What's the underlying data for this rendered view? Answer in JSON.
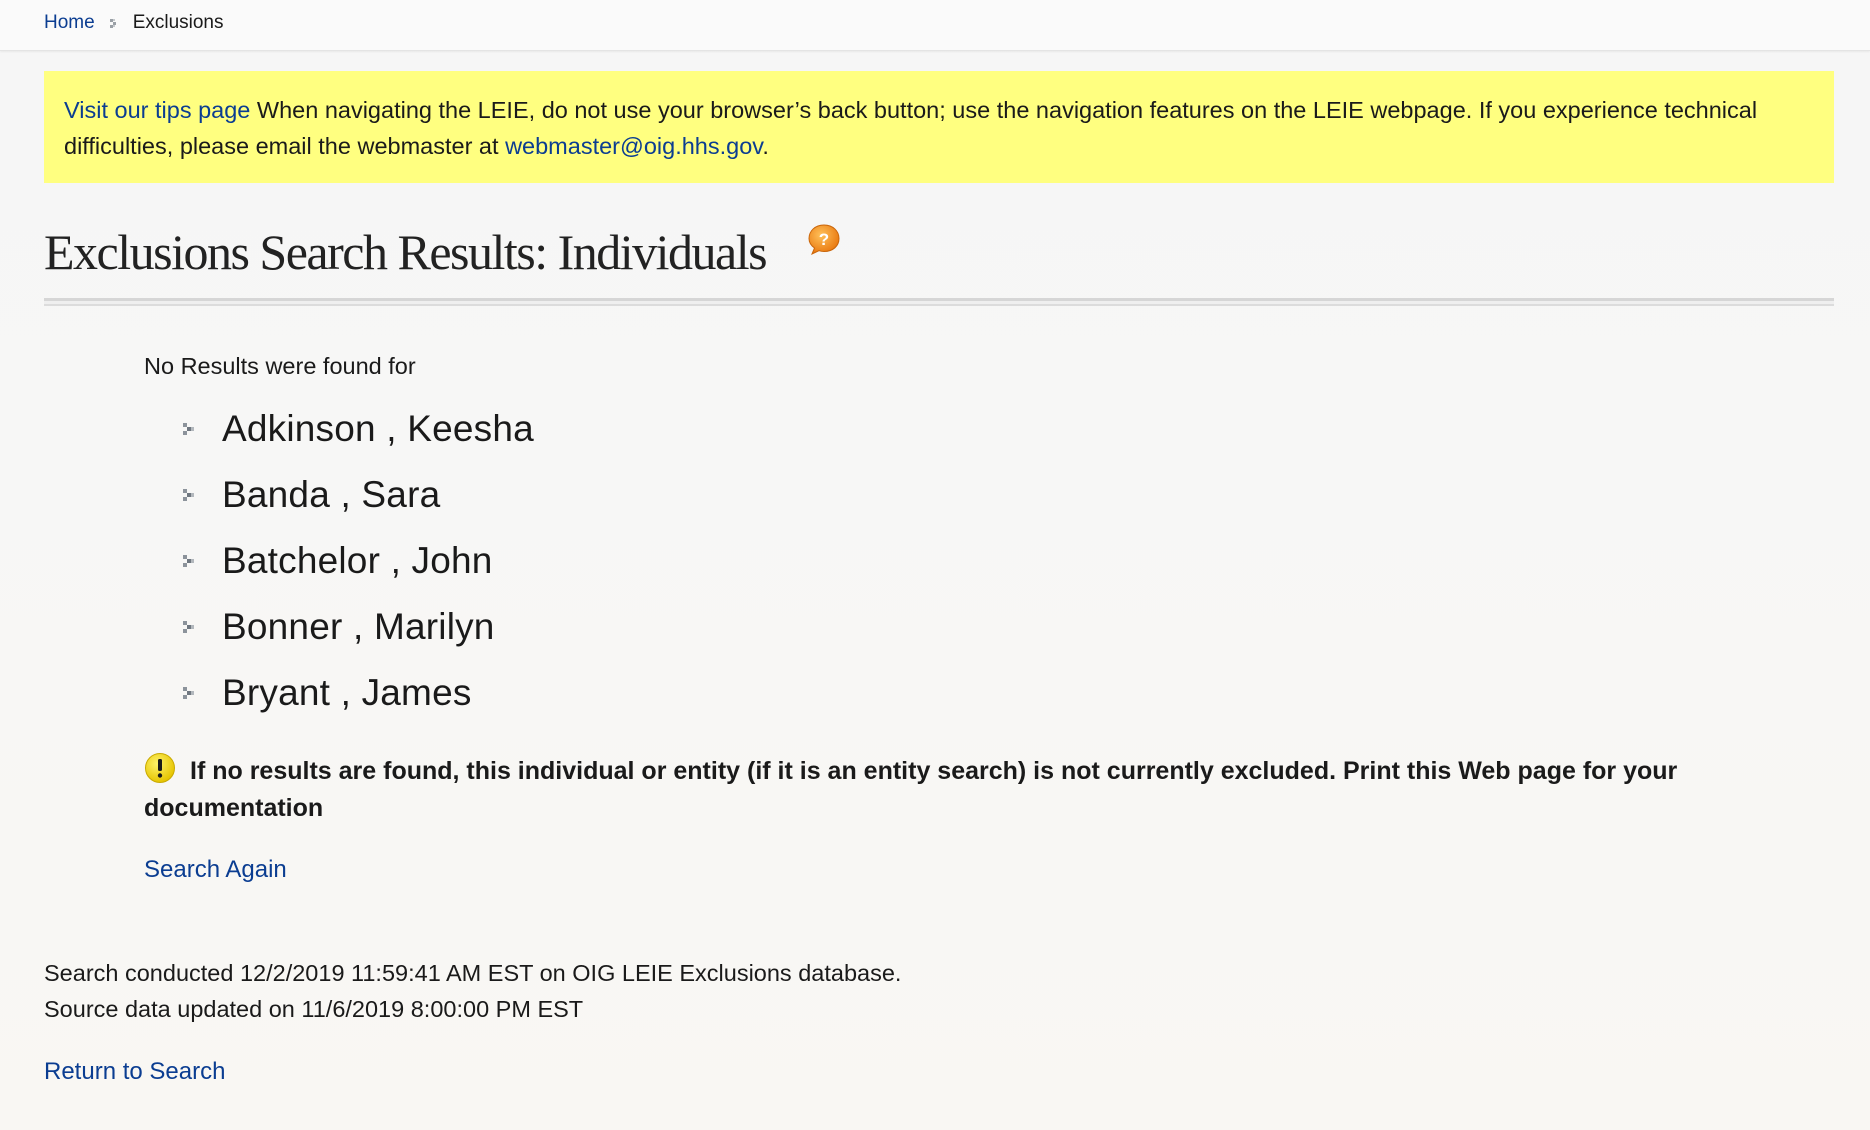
{
  "breadcrumb": {
    "home": "Home",
    "current": "Exclusions"
  },
  "tip": {
    "link_text": "Visit our tips page",
    "message": " When navigating the LEIE, do not use your browser’s back button; use the navigation features on the LEIE webpage. If you experience technical difficulties, please email the webmaster at ",
    "email": "webmaster@oig.hhs.gov",
    "end": "."
  },
  "page": {
    "title": "Exclusions Search Results: Individuals"
  },
  "results": {
    "label": "No Results were found for",
    "names": [
      "Adkinson , Keesha",
      "Banda , Sara",
      "Batchelor , John",
      "Bonner , Marilyn",
      "Bryant , James"
    ]
  },
  "notice": {
    "text": "If no results are found, this individual or entity (if it is an entity search) is not currently excluded. Print this Web page for your documentation"
  },
  "actions": {
    "search_again": "Search Again",
    "return_to_search": "Return to Search"
  },
  "meta": {
    "search_conducted": "Search conducted 12/2/2019 11:59:41 AM EST on OIG LEIE Exclusions database.",
    "source_updated": "Source data updated on 11/6/2019 8:00:00 PM EST"
  },
  "colors": {
    "link": "#0b3d91",
    "tip_background": "#ffff80",
    "help_icon": "#f08a1c",
    "warning_icon": "#f2d200"
  },
  "icons": {
    "help": "help-icon",
    "warning": "warning-icon",
    "bullet": "chevron-right-icon"
  }
}
